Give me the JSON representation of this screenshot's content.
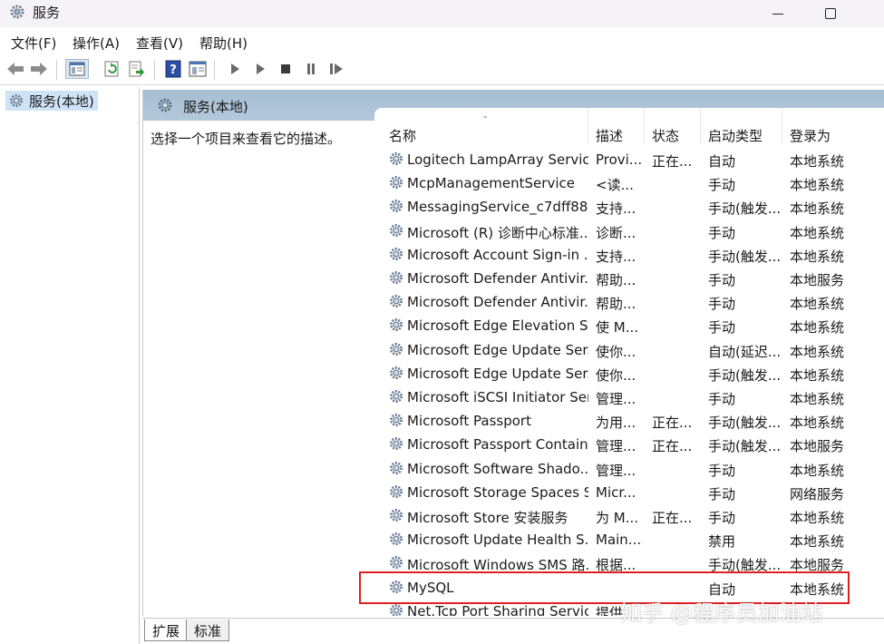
{
  "window": {
    "title": "服务"
  },
  "menu": [
    "文件(F)",
    "操作(A)",
    "查看(V)",
    "帮助(H)"
  ],
  "toolbar": {
    "icons": [
      "back-arrow-icon",
      "forward-arrow-icon",
      "console-tree-icon",
      "refresh-icon",
      "export-icon",
      "help-icon",
      "properties-icon",
      "play-icon",
      "play-alt-icon",
      "stop-icon",
      "pause-icon",
      "resume-icon"
    ]
  },
  "tree": {
    "root_label": "服务(本地)"
  },
  "content": {
    "header_title": "服务(本地)",
    "description_hint": "选择一个项目来查看它的描述。"
  },
  "columns": {
    "name": "名称",
    "description": "描述",
    "status": "状态",
    "startup_type": "启动类型",
    "logon_as": "登录为"
  },
  "rows": [
    {
      "name": "Logitech LampArray Service",
      "desc": "Provi...",
      "status": "正在...",
      "startup": "自动",
      "logon": "本地系统"
    },
    {
      "name": "McpManagementService",
      "desc": "<读...",
      "status": "",
      "startup": "手动",
      "logon": "本地系统"
    },
    {
      "name": "MessagingService_c7dff88",
      "desc": "支持...",
      "status": "",
      "startup": "手动(触发...",
      "logon": "本地系统"
    },
    {
      "name": "Microsoft (R) 诊断中心标准...",
      "desc": "诊断...",
      "status": "",
      "startup": "手动",
      "logon": "本地系统"
    },
    {
      "name": "Microsoft Account Sign-in ...",
      "desc": "支持...",
      "status": "",
      "startup": "手动(触发...",
      "logon": "本地系统"
    },
    {
      "name": "Microsoft Defender Antivir...",
      "desc": "帮助...",
      "status": "",
      "startup": "手动",
      "logon": "本地服务"
    },
    {
      "name": "Microsoft Defender Antivir...",
      "desc": "帮助...",
      "status": "",
      "startup": "手动",
      "logon": "本地系统"
    },
    {
      "name": "Microsoft Edge Elevation S...",
      "desc": "使 M...",
      "status": "",
      "startup": "手动",
      "logon": "本地系统"
    },
    {
      "name": "Microsoft Edge Update Ser...",
      "desc": "使你...",
      "status": "",
      "startup": "自动(延迟...",
      "logon": "本地系统"
    },
    {
      "name": "Microsoft Edge Update Ser...",
      "desc": "使你...",
      "status": "",
      "startup": "手动(触发...",
      "logon": "本地系统"
    },
    {
      "name": "Microsoft iSCSI Initiator Ser...",
      "desc": "管理...",
      "status": "",
      "startup": "手动",
      "logon": "本地系统"
    },
    {
      "name": "Microsoft Passport",
      "desc": "为用...",
      "status": "正在...",
      "startup": "手动(触发...",
      "logon": "本地系统"
    },
    {
      "name": "Microsoft Passport Container",
      "desc": "管理...",
      "status": "正在...",
      "startup": "手动(触发...",
      "logon": "本地服务"
    },
    {
      "name": "Microsoft Software Shado...",
      "desc": "管理...",
      "status": "",
      "startup": "手动",
      "logon": "本地系统"
    },
    {
      "name": "Microsoft Storage Spaces S...",
      "desc": "Micr...",
      "status": "",
      "startup": "手动",
      "logon": "网络服务"
    },
    {
      "name": "Microsoft Store 安装服务",
      "desc": "为 M...",
      "status": "正在...",
      "startup": "手动",
      "logon": "本地系统"
    },
    {
      "name": "Microsoft Update Health S...",
      "desc": "Main...",
      "status": "",
      "startup": "禁用",
      "logon": "本地系统"
    },
    {
      "name": "Microsoft Windows SMS 路...",
      "desc": "根据...",
      "status": "",
      "startup": "手动(触发...",
      "logon": "本地服务"
    },
    {
      "name": "MySQL",
      "desc": "",
      "status": "",
      "startup": "自动",
      "logon": "本地系统"
    },
    {
      "name": "Net.Tcp Port Sharing Service",
      "desc": "提供...",
      "status": "",
      "startup": "",
      "logon": ""
    }
  ],
  "tabs": [
    "扩展",
    "标准"
  ],
  "watermark": "知乎 @程序员加油站",
  "colors": {
    "highlight_border": "#e02020",
    "header_band": "#a6bdd2",
    "tree_selected": "#cfe3f7"
  }
}
